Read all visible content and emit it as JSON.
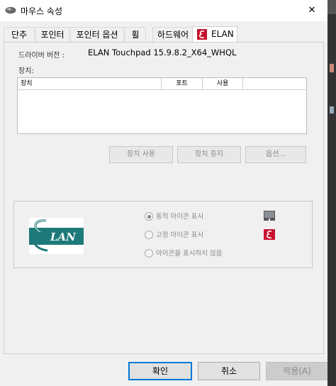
{
  "window": {
    "title": "마우스 속성",
    "close_glyph": "✕"
  },
  "tabs": [
    {
      "label": "단추"
    },
    {
      "label": "포인터"
    },
    {
      "label": "포인터 옵션"
    },
    {
      "label": "휠"
    },
    {
      "label": "하드웨어"
    },
    {
      "label": "ELAN",
      "active": true
    }
  ],
  "elan_panel": {
    "driver_version_label": "드라이버 버전 :",
    "driver_version_value": "ELAN Touchpad 15.9.8.2_X64_WHQL",
    "devices_label": "장치:",
    "device_list": {
      "columns": [
        "장치",
        "포트",
        "사용"
      ],
      "rows": []
    },
    "buttons": {
      "enable": "장치 사용",
      "disable": "장치 중지",
      "options": "옵션..."
    },
    "tray_icon_options": [
      {
        "label": "동적 아이콘 표시",
        "selected": true,
        "icon": "touchpad-tray-icon"
      },
      {
        "label": "고정 아이콘 표시",
        "selected": false,
        "icon": "elan-e-tray-icon"
      },
      {
        "label": "아이콘을 표시하지 않음",
        "selected": false
      }
    ],
    "logo_text": "LAN"
  },
  "footer": {
    "ok": "확인",
    "cancel": "취소",
    "apply": "적용(A)"
  },
  "colors": {
    "focus_border": "#0078d7",
    "elan_teal": "#1e7a7a",
    "elan_red": "#c8102e"
  }
}
